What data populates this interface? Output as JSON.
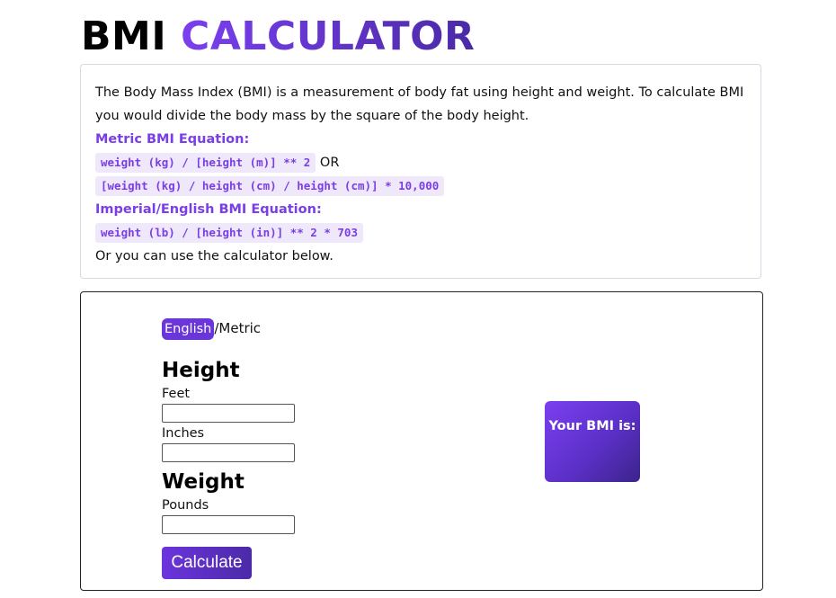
{
  "header": {
    "title_part1": "BMI",
    "title_part2": "CALCULATOR"
  },
  "info": {
    "intro": "The Body Mass Index (BMI) is a measurement of body fat using height and weight. To calculate BMI you would divide the body mass by the square of the body height.",
    "metric_title": "Metric BMI Equation:",
    "metric_eq1": "weight (kg) / [height (m)] ** 2",
    "or_text": "OR",
    "metric_eq2": "[weight (kg) / height (cm) / height (cm)] * 10,000",
    "imperial_title": "Imperial/English BMI Equation:",
    "imperial_eq": "weight (lb) / [height (in)] ** 2 * 703",
    "outro": "Or you can use the calculator below."
  },
  "calculator": {
    "toggle_english": "English",
    "toggle_separator": "/",
    "toggle_metric": "Metric",
    "height_heading": "Height",
    "feet_label": "Feet",
    "feet_value": "",
    "inches_label": "Inches",
    "inches_value": "",
    "weight_heading": "Weight",
    "pounds_label": "Pounds",
    "pounds_value": "",
    "calculate_label": "Calculate",
    "result_label": "Your BMI is:"
  }
}
